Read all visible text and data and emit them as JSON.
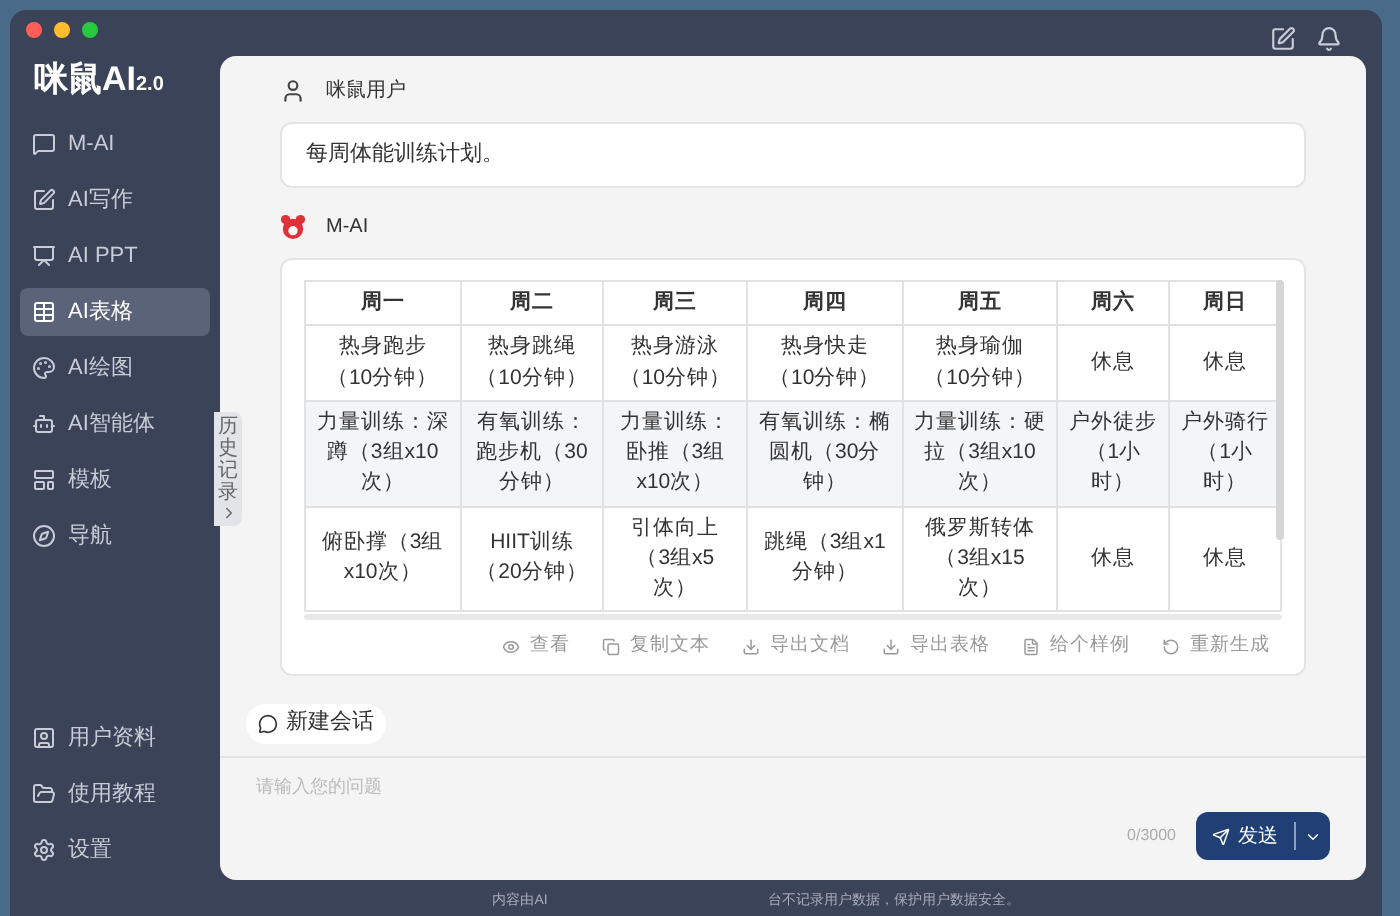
{
  "logo": {
    "text": "咪鼠AI",
    "version": "2.0"
  },
  "sidebar": {
    "items": [
      {
        "label": "M-AI",
        "selected": false
      },
      {
        "label": "AI写作",
        "selected": false
      },
      {
        "label": "AI PPT",
        "selected": false
      },
      {
        "label": "AI表格",
        "selected": true
      },
      {
        "label": "AI绘图",
        "selected": false
      },
      {
        "label": "AI智能体",
        "selected": false
      },
      {
        "label": "模板",
        "selected": false
      },
      {
        "label": "导航",
        "selected": false
      }
    ],
    "bottom_items": [
      "用户资料",
      "使用教程",
      "设置"
    ]
  },
  "history_tab": {
    "label": "历史记录"
  },
  "user_message": {
    "name": "咪鼠用户",
    "text": "每周体能训练计划。"
  },
  "assistant_message": {
    "name": "M-AI",
    "table": {
      "columns": [
        "周一",
        "周二",
        "周三",
        "周四",
        "周五",
        "周六",
        "周日"
      ],
      "rows": [
        [
          "热身跑步（10分钟）",
          "热身跳绳（10分钟）",
          "热身游泳（10分钟）",
          "热身快走（10分钟）",
          "热身瑜伽（10分钟）",
          "休息",
          "休息"
        ],
        [
          "力量训练：深蹲（3组x10次）",
          "有氧训练：跑步机（30分钟）",
          "力量训练：卧推（3组x10次）",
          "有氧训练：椭圆机（30分钟）",
          "力量训练：硬拉（3组x10次）",
          "户外徒步（1小时）",
          "户外骑行（1小时）"
        ],
        [
          "俯卧撑（3组x10次）",
          "HIIT训练（20分钟）",
          "引体向上（3组x5次）",
          "跳绳（3组x1分钟）",
          "俄罗斯转体（3组x15次）",
          "休息",
          "休息"
        ]
      ]
    },
    "actions": [
      "查看",
      "复制文本",
      "导出文档",
      "导出表格",
      "给个样例",
      "重新生成"
    ]
  },
  "new_chat": "新建会话",
  "input": {
    "placeholder": "请输入您的问题",
    "counter": "0/3000",
    "send": "发送"
  },
  "footer": [
    "内容由AI",
    "台不记录用户数据，保护用户数据安全。"
  ]
}
